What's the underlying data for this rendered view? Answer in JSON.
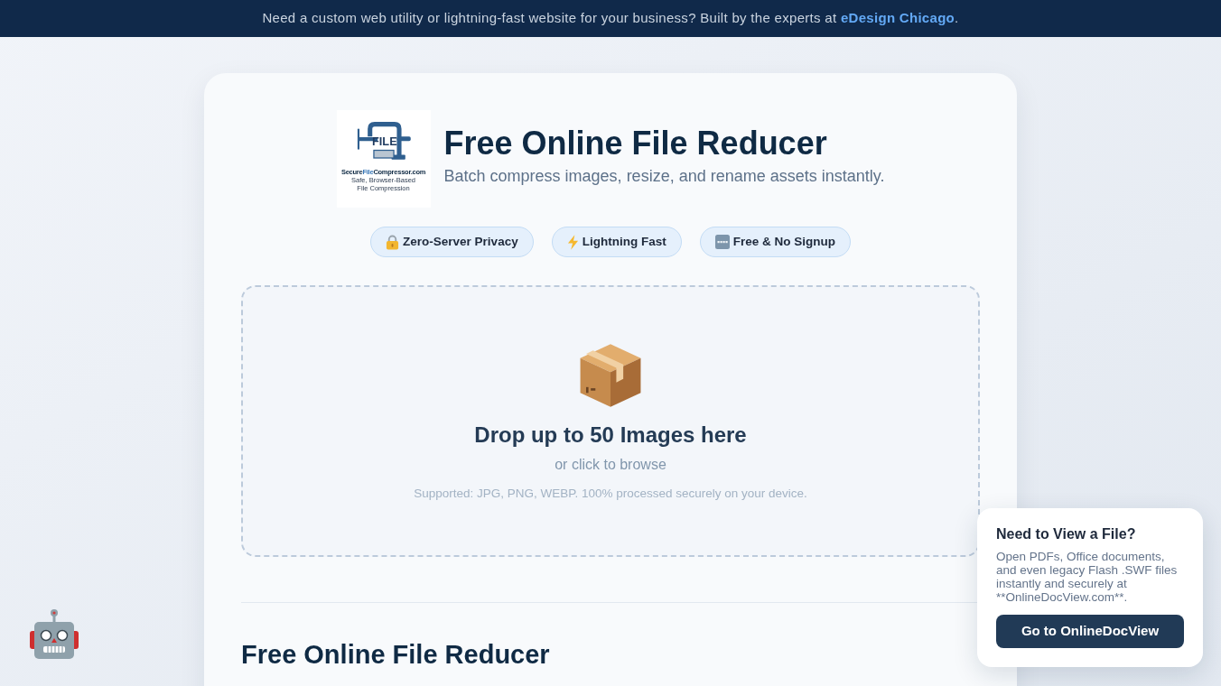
{
  "banner": {
    "text": "Need a custom web utility or lightning-fast website for your business? Built by the experts at",
    "link": "eDesign Chicago",
    "after": "."
  },
  "header": {
    "logo": {
      "mark": "FILE",
      "name_parts": [
        {
          "text": "Secure",
          "highlight": false
        },
        {
          "text": "File",
          "highlight": true
        },
        {
          "text": "Compressor.com",
          "highlight": false
        }
      ],
      "tagline": "Safe, Browser-Based File Compression"
    },
    "title": "Free Online File Reducer",
    "subtitle": "Batch compress images, resize, and rename assets instantly."
  },
  "badges": [
    {
      "kind": "lock",
      "label": "Zero-Server Privacy"
    },
    {
      "kind": "bolt",
      "label": "Lightning Fast"
    },
    {
      "kind": "free",
      "label": "Free & No Signup"
    }
  ],
  "dropzone": {
    "title": "Drop up to 50 Images here",
    "hint": "or click to browse",
    "note": "Supported: JPG, PNG, WEBP. 100% processed securely on your device."
  },
  "section": {
    "title": "Free Online File Reducer"
  },
  "promo": {
    "title": "Need to View a File?",
    "body": "Open PDFs, Office documents, and even legacy Flash .SWF files instantly and securely at **OnlineDocView.com**.",
    "button": "Go to OnlineDocView"
  }
}
